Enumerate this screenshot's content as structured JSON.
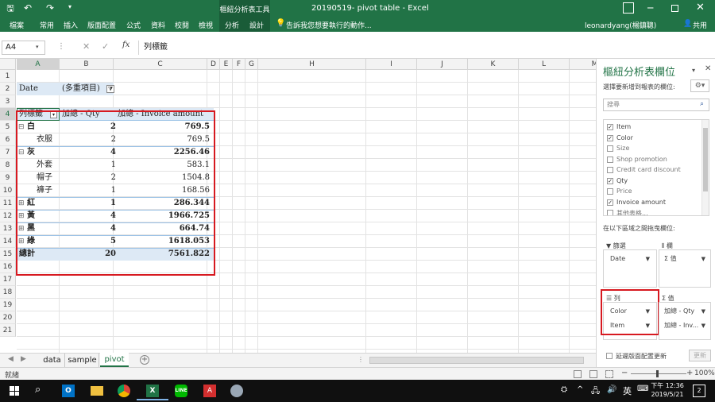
{
  "titlebar": {
    "title": "20190519- pivot table - Excel",
    "context_group": "樞紐分析表工具",
    "undo_icon": "↶",
    "redo_icon": "↷"
  },
  "ribbon": {
    "tabs": [
      "檔案",
      "常用",
      "插入",
      "版面配置",
      "公式",
      "資料",
      "校閱",
      "檢視",
      "分析",
      "設計"
    ],
    "tell_me": "告訴我您想要執行的動作...",
    "user": "leonardyang(楊鎮聰)",
    "share": "共用"
  },
  "formula_bar": {
    "name_box": "A4",
    "fx": "fx",
    "value": "列標籤"
  },
  "columns": [
    "A",
    "B",
    "C",
    "D",
    "E",
    "F",
    "G",
    "H",
    "I",
    "J",
    "K",
    "L",
    "M"
  ],
  "rows": [
    "1",
    "2",
    "3",
    "4",
    "5",
    "6",
    "7",
    "8",
    "9",
    "10",
    "11",
    "12",
    "13",
    "14",
    "15",
    "16",
    "17",
    "18",
    "19",
    "20",
    "21"
  ],
  "pivot": {
    "filter_label": "Date",
    "filter_value": "(多重項目)",
    "header": [
      "列標籤",
      "加總 - Qty",
      "加總 - Invoice amount"
    ],
    "rows": [
      {
        "label": "白",
        "qty": "2",
        "amt": "769.5",
        "level": 0,
        "toggle": "⊟"
      },
      {
        "label": "衣服",
        "qty": "2",
        "amt": "769.5",
        "level": 1,
        "toggle": ""
      },
      {
        "label": "灰",
        "qty": "4",
        "amt": "2256.46",
        "level": 0,
        "toggle": "⊟"
      },
      {
        "label": "外套",
        "qty": "1",
        "amt": "583.1",
        "level": 1,
        "toggle": ""
      },
      {
        "label": "帽子",
        "qty": "2",
        "amt": "1504.8",
        "level": 1,
        "toggle": ""
      },
      {
        "label": "褲子",
        "qty": "1",
        "amt": "168.56",
        "level": 1,
        "toggle": ""
      },
      {
        "label": "紅",
        "qty": "1",
        "amt": "286.344",
        "level": 0,
        "toggle": "⊞"
      },
      {
        "label": "黃",
        "qty": "4",
        "amt": "1966.725",
        "level": 0,
        "toggle": "⊞"
      },
      {
        "label": "黑",
        "qty": "4",
        "amt": "664.74",
        "level": 0,
        "toggle": "⊞"
      },
      {
        "label": "綠",
        "qty": "5",
        "amt": "1618.053",
        "level": 0,
        "toggle": "⊞"
      }
    ],
    "total": {
      "label": "總計",
      "qty": "20",
      "amt": "7561.822"
    }
  },
  "sheet_tabs": [
    "data",
    "sample",
    "pivot"
  ],
  "active_tab": "pivot",
  "status": {
    "ready": "就緒",
    "zoom": "100%"
  },
  "pane": {
    "title": "樞紐分析表欄位",
    "subtitle": "選擇要新增到報表的欄位:",
    "search_placeholder": "搜尋",
    "fields": [
      {
        "name": "Item",
        "checked": true
      },
      {
        "name": "Color",
        "checked": true
      },
      {
        "name": "Size",
        "checked": false
      },
      {
        "name": "Shop promotion",
        "checked": false
      },
      {
        "name": "Credit card discount",
        "checked": false
      },
      {
        "name": "Qty",
        "checked": true
      },
      {
        "name": "Price",
        "checked": false
      },
      {
        "name": "Invoice amount",
        "checked": true
      },
      {
        "name": "其他表格...",
        "checked": false
      }
    ],
    "drag_label": "在以下區域之間拖曳欄位:",
    "filters_label": "篩選",
    "columns_label": "欄",
    "rows_label": "列",
    "values_label": "值",
    "filter_items": [
      "Date"
    ],
    "column_items": [
      "Σ 值"
    ],
    "row_items": [
      "Color",
      "Item"
    ],
    "value_items": [
      "加總 - Qty",
      "加總 - Inv..."
    ],
    "defer_label": "延遲版面配置更新",
    "update_button": "更新"
  },
  "taskbar": {
    "time": "下午 12:36",
    "date": "2019/5/21",
    "ime": "英",
    "notif_count": "2"
  },
  "colors": {
    "excel_green": "#217346",
    "highlight_red": "#d71920",
    "pivot_header": "#dde9f5"
  }
}
